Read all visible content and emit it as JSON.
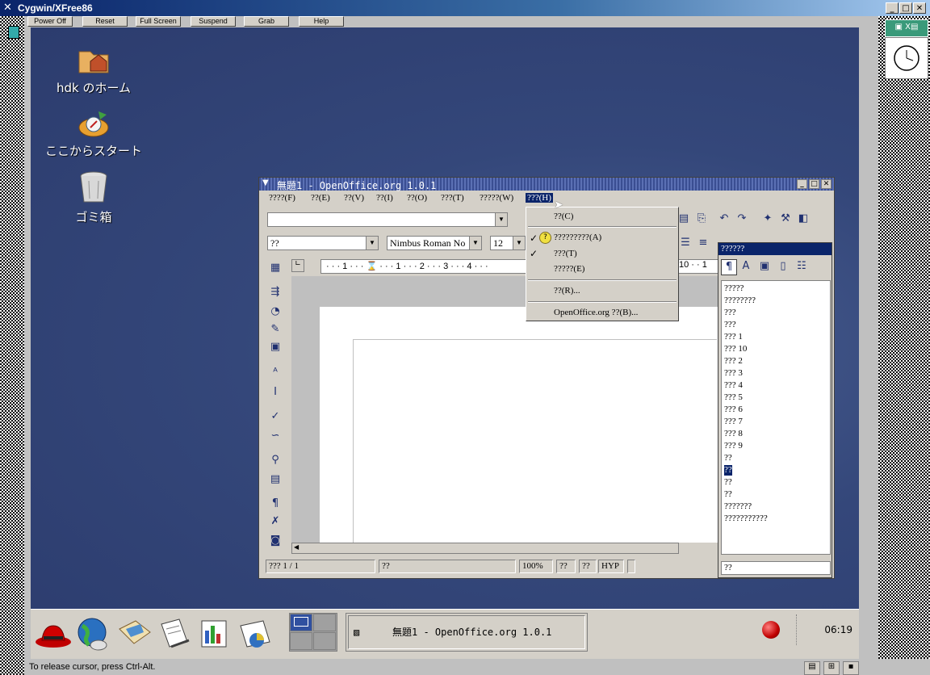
{
  "window": {
    "title": "Cygwin/XFree86"
  },
  "vm_toolbar": {
    "buttons": [
      "Power Off",
      "Reset",
      "Full Screen",
      "Suspend",
      "Grab",
      "Help"
    ]
  },
  "desktop": {
    "icons": [
      {
        "label": "hdk のホーム",
        "icon": "home-folder-icon"
      },
      {
        "label": "ここからスタート",
        "icon": "start-here-icon"
      },
      {
        "label": "ゴミ箱",
        "icon": "trash-icon"
      }
    ]
  },
  "openoffice": {
    "title": "無題1 - OpenOffice.org 1.0.1",
    "menubar": [
      "????(F)",
      "??(E)",
      "??(V)",
      "??(I)",
      "??(O)",
      "???(T)",
      "?????(W)",
      "???(H)"
    ],
    "font_style_value": "??",
    "font_name_value": "Nimbus Roman No",
    "font_size_value": "12",
    "ruler_text": "· · · 1 · · · ⌛ · · · 1 · · · 2 · · · 3 · · · 4 · · ·",
    "ruler_right": "10 · · 1",
    "status": {
      "page": "??? 1 / 1",
      "style": "??",
      "zoom": "100%",
      "mode1": "??",
      "mode2": "??",
      "hyp": "HYP"
    }
  },
  "help_menu": {
    "items": [
      "??(C)",
      "?????????(A)",
      "???(T)",
      "?????(E)",
      "??(R)...",
      "OpenOffice.org ??(B)..."
    ]
  },
  "stylist": {
    "title": "??????",
    "items": [
      "?????",
      "????????",
      "???",
      "???",
      "??? 1",
      "??? 10",
      "??? 2",
      "??? 3",
      "??? 4",
      "??? 5",
      "??? 6",
      "??? 7",
      "??? 8",
      "??? 9",
      "??",
      "??",
      "??",
      "??",
      "???????",
      "???????????"
    ],
    "selected_index": 15,
    "filter_value": "??"
  },
  "panel": {
    "task_label": "無題1 - OpenOffice.org 1.0.1",
    "clock": "06:19"
  },
  "status_bar": {
    "text": "To release cursor, press Ctrl-Alt."
  },
  "colors": {
    "desktop": "#34477a",
    "menu_highlight": "#0a246a",
    "panel": "#d4d0c8"
  }
}
